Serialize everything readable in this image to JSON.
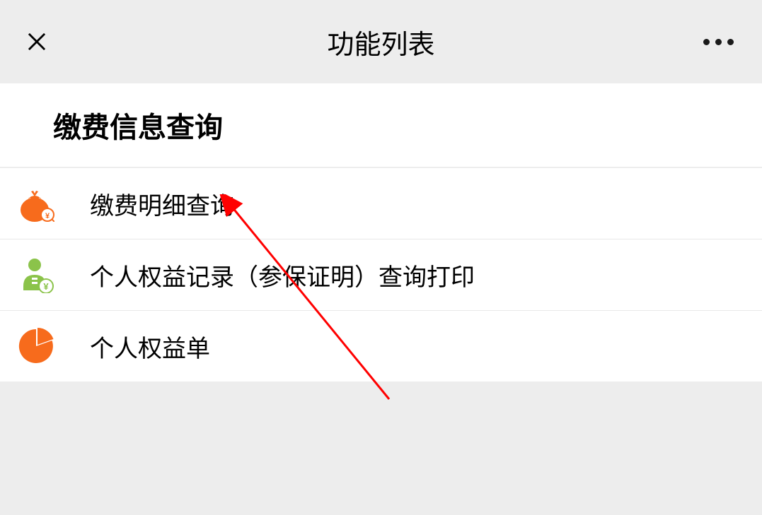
{
  "header": {
    "title": "功能列表"
  },
  "section": {
    "title": "缴费信息查询"
  },
  "items": [
    {
      "label": "缴费明细查询",
      "icon": "money-bag-icon"
    },
    {
      "label": "个人权益记录（参保证明）查询打印",
      "icon": "person-coin-icon"
    },
    {
      "label": "个人权益单",
      "icon": "pie-chart-icon"
    }
  ],
  "colors": {
    "orange": "#f76b1c",
    "green": "#8bc34a",
    "arrow": "#ff0000"
  }
}
